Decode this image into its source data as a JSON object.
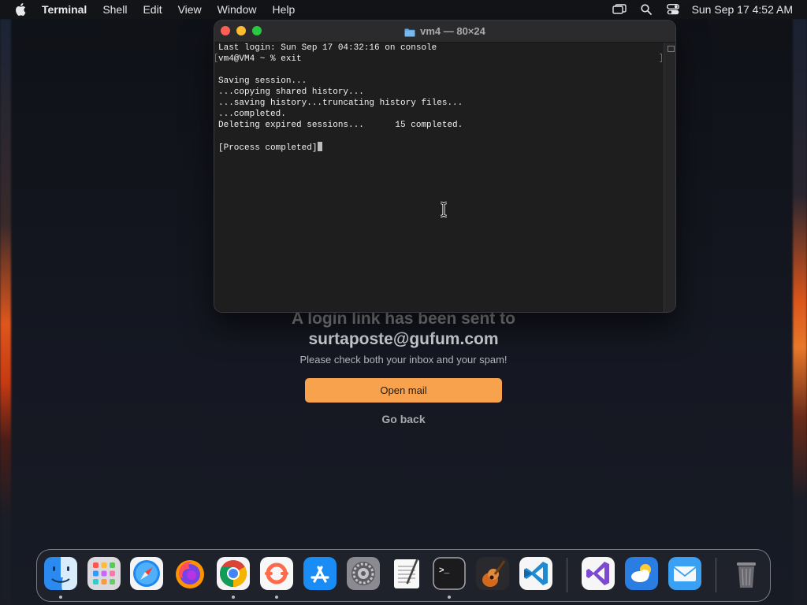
{
  "menubar": {
    "app_name": "Terminal",
    "menus": [
      "Shell",
      "Edit",
      "View",
      "Window",
      "Help"
    ],
    "clock": "Sun Sep 17  4:52 AM",
    "status_icons": [
      "screen-mirroring-icon",
      "spotlight-search-icon",
      "control-center-icon"
    ]
  },
  "terminal": {
    "title": "vm4 — 80×24",
    "lines": [
      "Last login: Sun Sep 17 04:32:16 on console",
      "vm4@VM4 ~ % exit",
      "",
      "Saving session...",
      "...copying shared history...",
      "...saving history...truncating history files...",
      "...completed.",
      "Deleting expired sessions...      15 completed.",
      "",
      "[Process completed]"
    ]
  },
  "login": {
    "title": "A login link has been sent to",
    "email": "surtaposte@gufum.com",
    "hint": "Please check both your inbox and your spam!",
    "open_mail_label": "Open mail",
    "go_back_label": "Go back"
  },
  "dock": {
    "apps": [
      {
        "name": "finder-icon",
        "running": true
      },
      {
        "name": "launchpad-icon",
        "running": false
      },
      {
        "name": "safari-icon",
        "running": false
      },
      {
        "name": "firefox-icon",
        "running": false
      },
      {
        "name": "chrome-icon",
        "running": true
      },
      {
        "name": "arc-like-app-icon",
        "running": true
      },
      {
        "name": "app-store-icon",
        "running": false
      },
      {
        "name": "system-settings-icon",
        "running": false
      },
      {
        "name": "textedit-icon",
        "running": false
      },
      {
        "name": "terminal-icon",
        "running": true
      },
      {
        "name": "garageband-icon",
        "running": false
      },
      {
        "name": "vscode-icon",
        "running": false
      },
      {
        "name": "visual-studio-icon",
        "running": false
      },
      {
        "name": "weather-icon",
        "running": false
      },
      {
        "name": "mail-icon",
        "running": false
      },
      {
        "name": "trash-icon",
        "running": false
      }
    ]
  }
}
